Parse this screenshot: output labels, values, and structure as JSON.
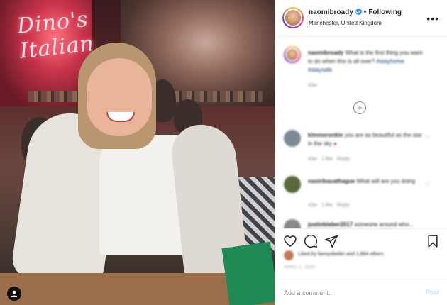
{
  "post": {
    "photo_alt": "",
    "neon_sign": "Dino's Italian"
  },
  "header": {
    "username": "naomibroady",
    "follow_status": "Following",
    "location": "Manchester, United Kingdom",
    "more_icon": "more-horizontal-icon"
  },
  "caption": {
    "username": "naomibroady",
    "text": "What is the first thing you want to do when this is all over?",
    "hashtags": "#stayhome #staysafe",
    "time": "43w"
  },
  "comments": [
    {
      "username": "kimmeronkie",
      "text": "you are as beautiful as the star in the sky",
      "time": "43w",
      "likes": "1 like",
      "reply": "Reply"
    },
    {
      "username": "nasiribauathague",
      "text": "What will are you doing",
      "time": "43w",
      "likes": "1 like",
      "reply": "Reply"
    },
    {
      "username": "justinbieber2017",
      "text": "someone around who...",
      "time": "",
      "likes": "",
      "reply": ""
    }
  ],
  "actions": {
    "like_icon": "heart-icon",
    "comment_icon": "comment-icon",
    "share_icon": "paper-plane-icon",
    "save_icon": "bookmark-icon"
  },
  "likes_line": "Liked by fannyobelier and 1,884 others",
  "date": "APRIL 2, 2020",
  "comment_box": {
    "placeholder": "Add a comment...",
    "post_label": "Post"
  },
  "colors": {
    "accent": "#3897f0",
    "post_disabled": "#b2dffc",
    "muted": "#8e8e8e"
  }
}
